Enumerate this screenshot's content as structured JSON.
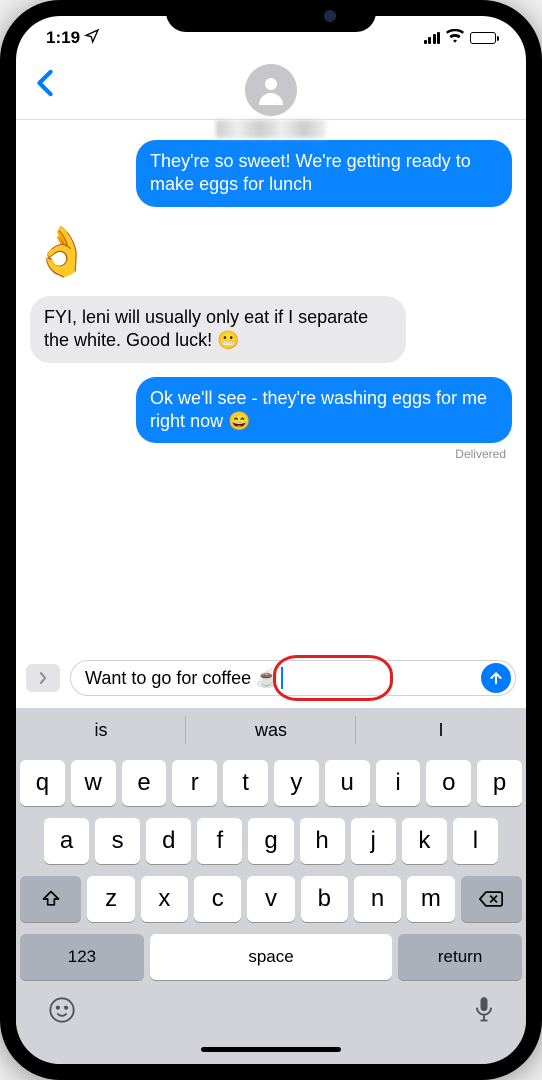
{
  "status": {
    "time": "1:19",
    "location_icon": "location-arrow"
  },
  "header": {
    "back_label": "‹",
    "contact_name": "██████"
  },
  "messages": [
    {
      "side": "sent",
      "text": "They're so sweet! We're getting ready to make eggs for lunch"
    },
    {
      "side": "received-emoji",
      "text": "👌"
    },
    {
      "side": "received",
      "text": "FYI, leni will usually only eat if I separate the white. Good luck! 😬"
    },
    {
      "side": "sent",
      "text": "Ok we'll see - they're washing eggs for me right now 😄"
    }
  ],
  "delivered_label": "Delivered",
  "input": {
    "draft": "Want to go for coffee ☕️",
    "highlighted_word": "coffee"
  },
  "predictive": [
    "is",
    "was",
    "I"
  ],
  "keyboard": {
    "row1": [
      "q",
      "w",
      "e",
      "r",
      "t",
      "y",
      "u",
      "i",
      "o",
      "p"
    ],
    "row2": [
      "a",
      "s",
      "d",
      "f",
      "g",
      "h",
      "j",
      "k",
      "l"
    ],
    "row3": [
      "z",
      "x",
      "c",
      "v",
      "b",
      "n",
      "m"
    ],
    "shift_label": "⇧",
    "backspace_label": "⌫",
    "numeric_label": "123",
    "space_label": "space",
    "return_label": "return"
  },
  "colors": {
    "ios_blue": "#007aff",
    "sent_bubble": "#0a84ff",
    "received_bubble": "#e9e9eb",
    "annotation_red": "#e02020"
  }
}
